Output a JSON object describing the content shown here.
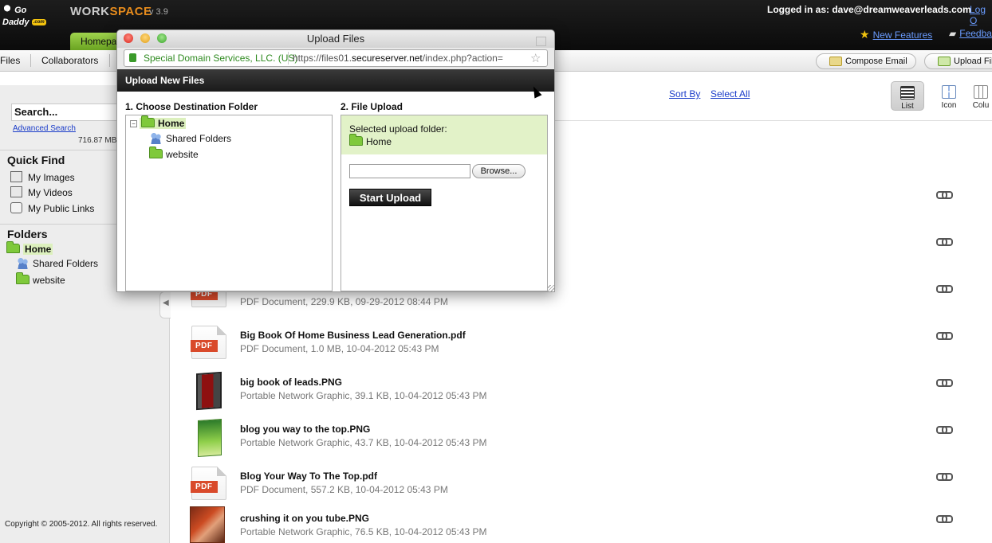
{
  "header": {
    "logo_text": "Go Daddy",
    "logo_badge": ".com",
    "app_name_a": "WORK",
    "app_name_b": "SPACE",
    "version": "v 3.9",
    "logged_in": "Logged in as: dave@dreamweaverleads.com",
    "logout": "Log O",
    "home_tab": "Homepa",
    "new_features": "New Features",
    "feedback": "Feedba"
  },
  "nav": {
    "files": "Files",
    "collaborators": "Collaborators",
    "compose_email": "Compose Email",
    "upload_files": "Upload Fil"
  },
  "sidebar": {
    "search_placeholder": "Search...",
    "advanced_search": "Advanced Search",
    "storage_used": "716.87 MB",
    "quick_find_title": "Quick Find",
    "quick_find": [
      {
        "label": "My Images",
        "icon": "images-icon"
      },
      {
        "label": "My Videos",
        "icon": "videos-icon"
      },
      {
        "label": "My Public Links",
        "icon": "public-links-icon"
      }
    ],
    "folders_title": "Folders",
    "folders": [
      {
        "label": "Home"
      },
      {
        "label": "Shared Folders"
      },
      {
        "label": "website"
      }
    ],
    "copyright": "Copyright © 2005-2012. All rights reserved."
  },
  "toolbar": {
    "sort_by": "Sort By",
    "select_all": "Select All",
    "views": [
      {
        "label": "List",
        "selected": true
      },
      {
        "label": "Icon",
        "selected": false
      },
      {
        "label": "Colu",
        "selected": false
      }
    ]
  },
  "files": [
    {
      "name": "",
      "meta": "PDF Document, 229.9 KB, 09-29-2012 08:44 PM",
      "type": "pdf"
    },
    {
      "name": "Big Book Of Home Business Lead Generation.pdf",
      "meta": "PDF Document, 1.0 MB, 10-04-2012 05:43 PM",
      "type": "pdf"
    },
    {
      "name": "big book of leads.PNG",
      "meta": "Portable Network Graphic, 39.1 KB, 10-04-2012 05:43 PM",
      "type": "png"
    },
    {
      "name": "blog you way to the top.PNG",
      "meta": "Portable Network Graphic, 43.7 KB, 10-04-2012 05:43 PM",
      "type": "png"
    },
    {
      "name": "Blog Your Way To The Top.pdf",
      "meta": "PDF Document, 557.2 KB, 10-04-2012 05:43 PM",
      "type": "pdf"
    },
    {
      "name": "crushing it on you tube.PNG",
      "meta": "Portable Network Graphic, 76.5 KB, 10-04-2012 05:43 PM",
      "type": "png"
    }
  ],
  "pdf_badge": "PDF",
  "dialog": {
    "window_title": "Upload Files",
    "url_org": "Special Domain Services, LLC. (US)",
    "url_prefix": "https://files01.",
    "url_domain": "secureserver.net",
    "url_path": "/index.php?action=",
    "header": "Upload New Files",
    "close": "x",
    "dest_label": "1. Choose Destination Folder",
    "upload_label": "2. File Upload",
    "tree_toggle": "−",
    "tree": {
      "home": "Home",
      "shared": "Shared Folders",
      "website": "website"
    },
    "selected_folder_label": "Selected upload folder:",
    "selected_folder": "Home",
    "browse": "Browse...",
    "start_upload": "Start Upload"
  }
}
